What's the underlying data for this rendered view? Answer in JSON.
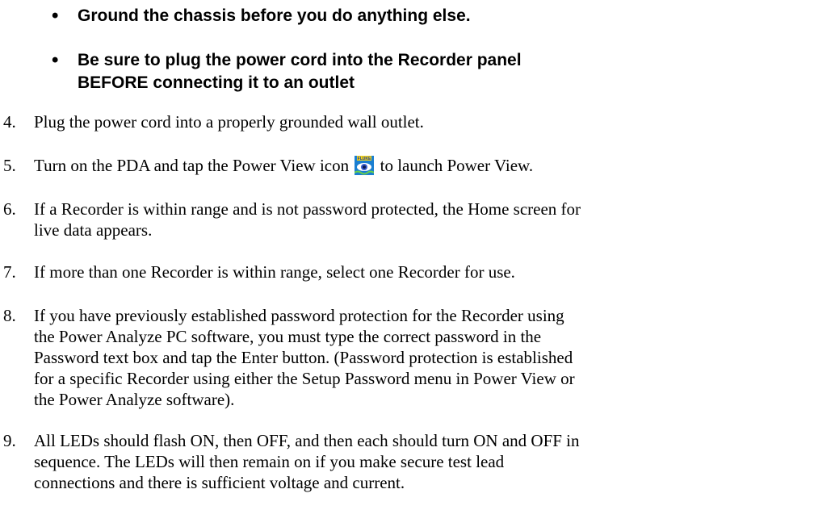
{
  "warnings": [
    "Ground the chassis before you do anything else.",
    [
      "Be sure to plug the power cord into the Recorder panel",
      "BEFORE connecting it to an outlet"
    ]
  ],
  "bullet_char": "•",
  "steps": [
    {
      "num": "4.",
      "lines": [
        "Plug the power cord into a properly grounded wall outlet."
      ]
    },
    {
      "num": "5.",
      "before_icon": "Turn on the PDA and tap the Power View icon",
      "icon": "power-view-app-icon",
      "after_icon": "to launch Power View."
    },
    {
      "num": "6.",
      "lines": [
        "If a Recorder is within range and is not password protected, the Home screen for",
        "live data appears."
      ]
    },
    {
      "num": "7.",
      "lines": [
        "If more than one Recorder is within range, select one Recorder for use."
      ]
    },
    {
      "num": "8.",
      "lines": [
        "If you have previously established password protection for the Recorder using",
        "the Power Analyze PC software, you must type the correct password in the",
        "Password text box and tap the Enter button. (Password protection is established",
        "for a specific Recorder using either the Setup Password menu in Power View or",
        "the Power Analyze software)."
      ]
    },
    {
      "num": "9.",
      "lines": [
        "All LEDs should flash ON, then OFF, and then each should turn ON and OFF in",
        "sequence. The LEDs will then remain on if you make secure test lead",
        "connections and there is sufficient voltage and current."
      ]
    }
  ],
  "icon_label": "FLUKE",
  "colors": {
    "text": "#000000",
    "icon_bg": "#1a7fd1",
    "icon_label_bg": "#f2d21a"
  }
}
